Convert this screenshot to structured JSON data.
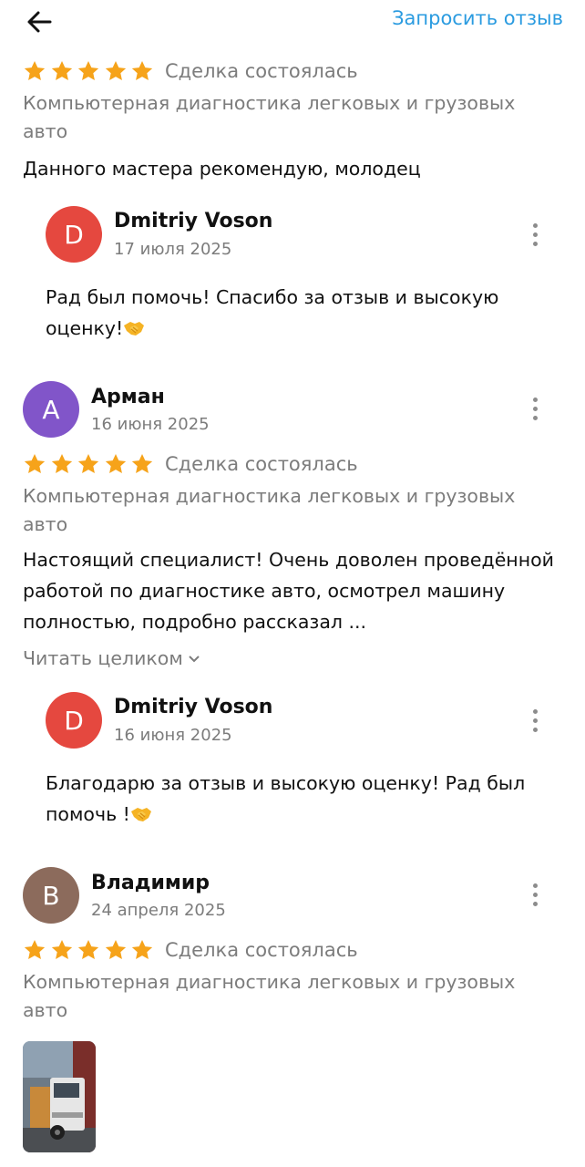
{
  "header": {
    "request_label": "Запросить отзыв"
  },
  "colors": {
    "accent": "#2a9be0",
    "star": "#f6a31a",
    "avatar_d": "#e5483f",
    "avatar_a": "#8155c9",
    "avatar_v": "#8c6b5c"
  },
  "reviews": [
    {
      "deal": "Сделка состоялась",
      "service": "Компьютерная диагностика легковых и грузовых авто",
      "text": "Данного мастера рекомендую, молодец",
      "reply": {
        "initial": "D",
        "name": "Dmitriy Voson",
        "date": "17 июля 2025",
        "text": "Рад был помочь! Спасибо за отзыв и высокую оценку!",
        "emoji": "handshake-emoji"
      }
    },
    {
      "initial": "А",
      "name": "Арман",
      "date": "16 июня 2025",
      "deal": "Сделка состоялась",
      "service": "Компьютерная диагностика легковых и грузовых авто",
      "text": "Настоящий специалист!  Очень доволен проведённой работой по диагностике авто, осмотрел машину полностью, подробно рассказал ...",
      "read_more": "Читать целиком",
      "reply": {
        "initial": "D",
        "name": "Dmitriy Voson",
        "date": "16 июня 2025",
        "text": "Благодарю за отзыв и высокую оценку! Рад был помочь !",
        "emoji": "handshake-emoji"
      }
    },
    {
      "initial": "В",
      "name": "Владимир",
      "date": "24 апреля 2025",
      "deal": "Сделка состоялась",
      "service": "Компьютерная диагностика легковых и грузовых авто",
      "photo": "truck-photo"
    }
  ]
}
